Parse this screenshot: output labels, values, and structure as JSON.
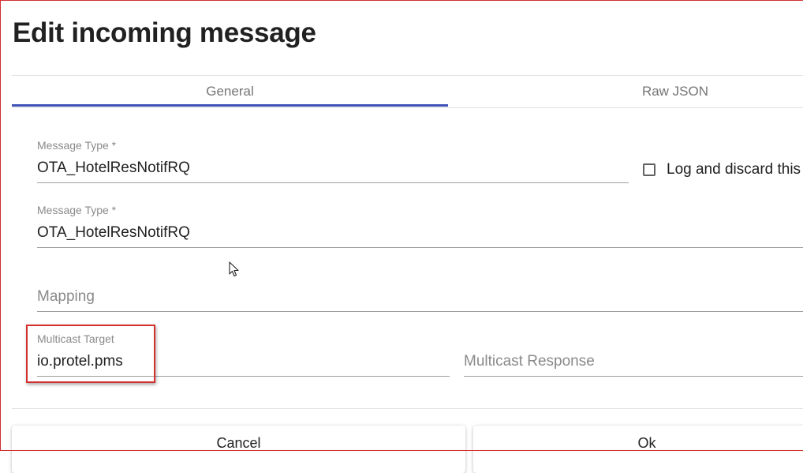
{
  "dialog": {
    "title": "Edit incoming message"
  },
  "tabs": [
    {
      "label": "General",
      "active": true
    },
    {
      "label": "Raw JSON",
      "active": false
    }
  ],
  "form": {
    "message_type_1": {
      "label": "Message Type *",
      "value": "OTA_HotelResNotifRQ"
    },
    "log_discard": {
      "label": "Log and discard this",
      "checked": false
    },
    "message_type_2": {
      "label": "Message Type *",
      "value": "OTA_HotelResNotifRQ"
    },
    "mapping": {
      "placeholder": "Mapping",
      "value": ""
    },
    "multicast_target": {
      "label": "Multicast Target",
      "value": "io.protel.pms"
    },
    "multicast_response": {
      "placeholder": "Multicast Response",
      "value": ""
    }
  },
  "actions": {
    "cancel_label": "Cancel",
    "ok_label": "Ok"
  },
  "colors": {
    "tab_indicator": "#3f51b5",
    "highlight_border": "#d32f2f"
  },
  "icons": {
    "cursor": "mouse-pointer-icon"
  }
}
